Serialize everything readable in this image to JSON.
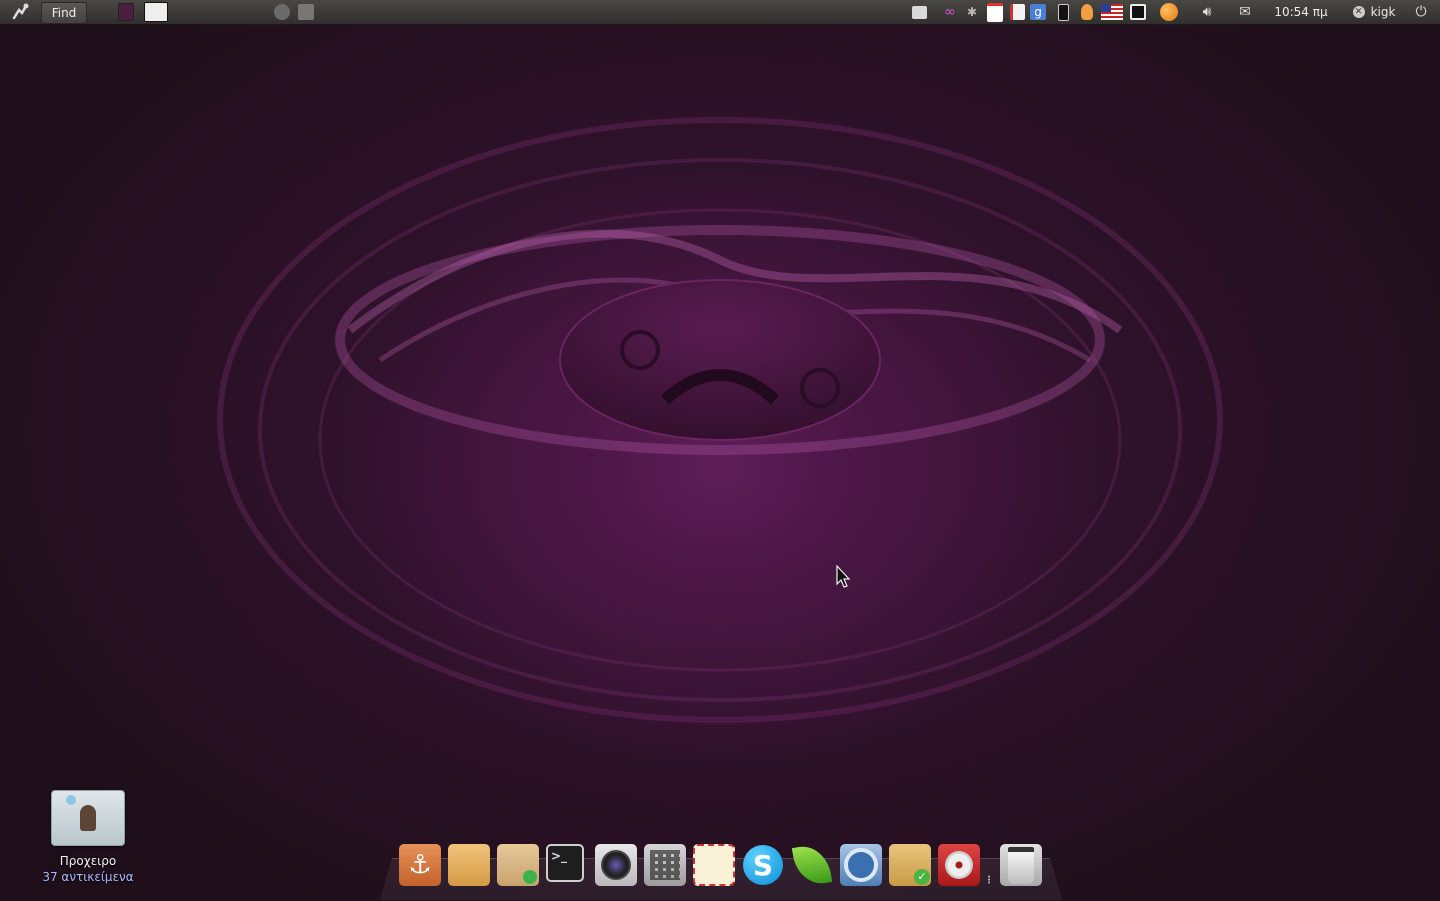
{
  "top_panel": {
    "find_label": "Find",
    "clock": "10:54 πμ",
    "user_name": "kigk"
  },
  "desktop": {
    "folder": {
      "name": "Προχειρο",
      "count": "37 αντικείμενα"
    }
  },
  "dock": {
    "items": [
      {
        "icon": "anchor-icon"
      },
      {
        "icon": "folder-icon"
      },
      {
        "icon": "package-installer-icon"
      },
      {
        "icon": "terminal-icon"
      },
      {
        "icon": "camera-icon"
      },
      {
        "icon": "calculator-icon"
      },
      {
        "icon": "mail-envelope-icon"
      },
      {
        "icon": "skype-icon"
      },
      {
        "icon": "leaf-icon"
      },
      {
        "icon": "chromium-icon"
      },
      {
        "icon": "home-folder-icon"
      },
      {
        "icon": "music-player-icon"
      },
      {
        "icon": "trash-icon"
      }
    ],
    "terminal_glyph": ">_",
    "skype_glyph": "S"
  },
  "colors": {
    "accent": "#5a1e54",
    "panel": "#3c3b37",
    "link": "#a9b7ff"
  }
}
